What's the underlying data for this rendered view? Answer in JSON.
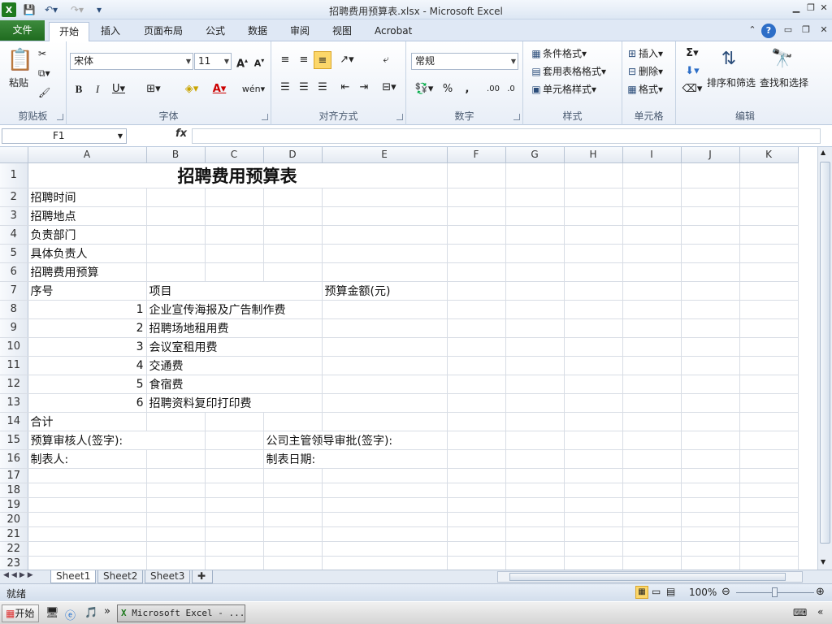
{
  "window": {
    "title": "招聘费用预算表.xlsx  -  Microsoft Excel"
  },
  "tabs": {
    "file": "文件",
    "home": "开始",
    "insert": "插入",
    "layout": "页面布局",
    "formulas": "公式",
    "data": "数据",
    "review": "审阅",
    "view": "视图",
    "acrobat": "Acrobat"
  },
  "ribbon": {
    "clipboard": {
      "label": "剪贴板",
      "paste": "粘贴"
    },
    "font": {
      "label": "字体",
      "name": "宋体",
      "size": "11"
    },
    "align": {
      "label": "对齐方式"
    },
    "number": {
      "label": "数字",
      "format": "常规"
    },
    "styles": {
      "label": "样式",
      "conditional": "条件格式",
      "table": "套用表格格式",
      "cell": "单元格样式"
    },
    "cells": {
      "label": "单元格",
      "insert": "插入",
      "delete": "删除",
      "format": "格式"
    },
    "editing": {
      "label": "编辑",
      "sort": "排序和筛选",
      "find": "查找和选择"
    }
  },
  "formula": {
    "namebox": "F1",
    "fx": "fx",
    "value": ""
  },
  "sheet": {
    "columns": [
      "A",
      "B",
      "C",
      "D",
      "E",
      "F",
      "G",
      "H",
      "I",
      "J",
      "K"
    ],
    "title": "招聘费用预算表",
    "r2": "招聘时间",
    "r3": "招聘地点",
    "r4": "负责部门",
    "r5": "具体负责人",
    "r6": "招聘费用预算",
    "r7a": "序号",
    "r7b": "项目",
    "r7e": "预算金额(元)",
    "items": [
      {
        "no": "1",
        "name": "企业宣传海报及广告制作费"
      },
      {
        "no": "2",
        "name": "招聘场地租用费"
      },
      {
        "no": "3",
        "name": "会议室租用费"
      },
      {
        "no": "4",
        "name": "交通费"
      },
      {
        "no": "5",
        "name": "食宿费"
      },
      {
        "no": "6",
        "name": "招聘资料复印打印费"
      }
    ],
    "r14": "合计",
    "r15a": "预算审核人(签字):",
    "r15d": "公司主管领导审批(签字):",
    "r16a": "制表人:",
    "r16d": "制表日期:",
    "rows": [
      "1",
      "2",
      "3",
      "4",
      "5",
      "6",
      "7",
      "8",
      "9",
      "10",
      "11",
      "12",
      "13",
      "14",
      "15",
      "16",
      "17",
      "18",
      "19",
      "20",
      "21",
      "22",
      "23"
    ]
  },
  "sheettabs": [
    "Sheet1",
    "Sheet2",
    "Sheet3"
  ],
  "status": {
    "ready": "就绪",
    "zoom": "100%"
  },
  "taskbar": {
    "start": "开始",
    "task": "Microsoft Excel - ..."
  }
}
